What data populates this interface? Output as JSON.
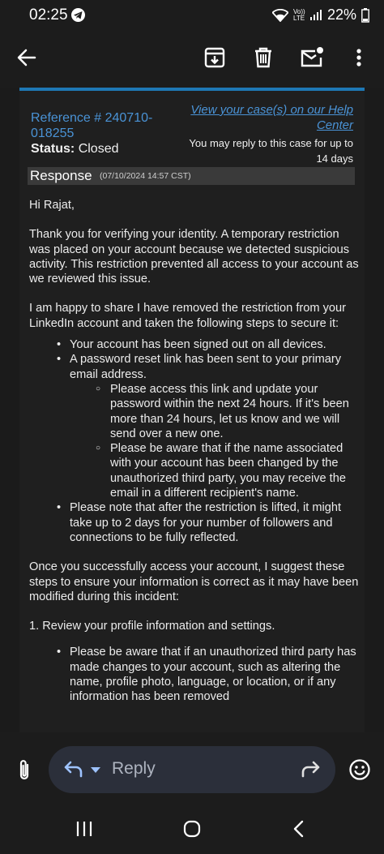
{
  "status_bar": {
    "time": "02:25",
    "network_label": "Vo)) LTE",
    "battery": "22%"
  },
  "app_bar": {
    "icons": [
      "back-arrow-icon",
      "archive-icon",
      "delete-icon",
      "mark-unread-icon",
      "more-vert-icon"
    ]
  },
  "email": {
    "reference": "Reference # 240710-018255",
    "status_label": "Status:",
    "status_value": "Closed",
    "help_link": "View your case(s) on our Help Center",
    "reply_note": "You may reply to this case for up to 14 days",
    "response_title": "Response",
    "response_date": "(07/10/2024 14:57 CST)",
    "greeting": "Hi Rajat,",
    "para1": "Thank you for verifying your identity. A temporary restriction was placed on your account because we detected suspicious activity. This restriction prevented all access to your account as we reviewed this issue.",
    "para2": "I am happy to share I have removed the restriction from your LinkedIn account and taken the following steps to secure it:",
    "bullets": [
      "Your account has been signed out on all devices.",
      "A password reset link has been sent to your primary email address.",
      "Please note that after the restriction is lifted, it might take up to 2 days for your number of followers and connections to be fully reflected."
    ],
    "sub_bullets": [
      "Please access this link and update your password within the next 24 hours. If it's been more than 24 hours, let us know and we will send over a new one.",
      "Please be aware that if the name associated with your account has been changed by the unauthorized third party, you may receive the email in a different recipient's name."
    ],
    "para3": "Once you successfully access your account, I suggest these steps to ensure your information is correct as it may have been modified during this incident:",
    "step1": "1. Review your profile information and settings.",
    "bullet_after_step": "Please be aware that if an unauthorized third party has made changes to your account, such as altering the name, profile photo, language, or location, or if any information has been removed"
  },
  "compose": {
    "reply_label": "Reply"
  },
  "colors": {
    "link": "#4a93d6",
    "accent_bar": "#1e78b5",
    "background": "#1f1f1f"
  }
}
